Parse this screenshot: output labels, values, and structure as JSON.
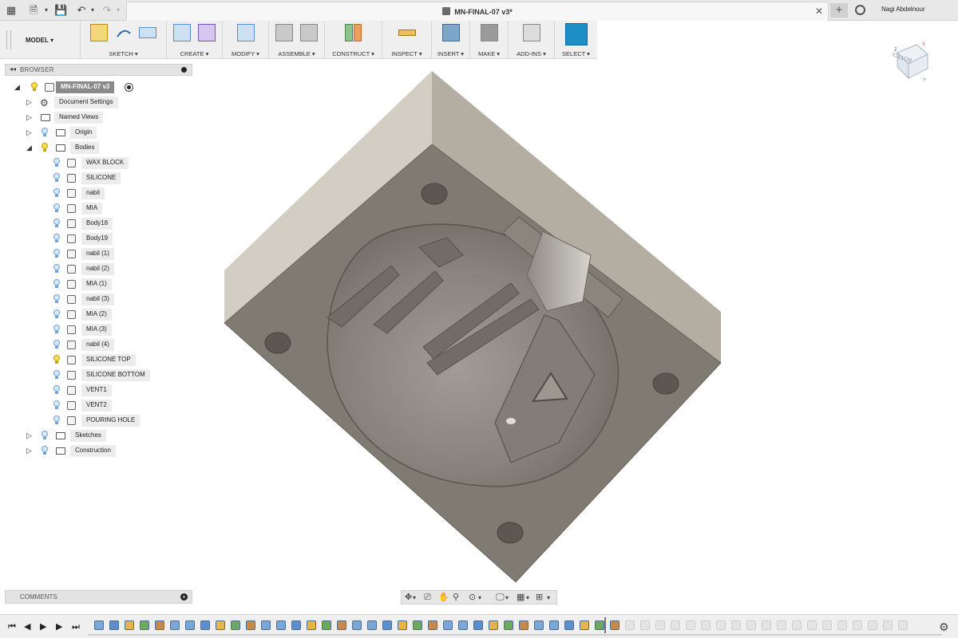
{
  "app": {
    "document_title": "MN-FINAL-07 v3*",
    "user_name": "Nagi Abdelnour"
  },
  "toolbar": {
    "workspace": "MODEL",
    "groups": [
      {
        "label": "SKETCH"
      },
      {
        "label": "CREATE"
      },
      {
        "label": "MODIFY"
      },
      {
        "label": "ASSEMBLE"
      },
      {
        "label": "CONSTRUCT"
      },
      {
        "label": "INSPECT"
      },
      {
        "label": "INSERT"
      },
      {
        "label": "MAKE"
      },
      {
        "label": "ADD-INS"
      },
      {
        "label": "SELECT"
      }
    ]
  },
  "browser": {
    "title": "BROWSER",
    "root": "MN-FINAL-07 v3",
    "top_items": [
      "Document Settings",
      "Named Views",
      "Origin",
      "Bodies"
    ],
    "bodies": [
      "WAX BLOCK",
      "SILICONE",
      "nabil",
      "MIA",
      "Body18",
      "Body19",
      "nabil (1)",
      "nabil (2)",
      "MIA (1)",
      "nabil (3)",
      "MIA (2)",
      "MIA (3)",
      "nabil (4)",
      "SILICONE TOP",
      "SILICONE BOTTOM",
      "VENT1",
      "VENT2",
      "POURING HOLE"
    ],
    "bottom_items": [
      "Sketches",
      "Construction"
    ]
  },
  "comments": {
    "title": "COMMENTS"
  },
  "viewcube": {
    "face": "BOTTOM",
    "axes": [
      "X",
      "Y",
      "Z"
    ]
  },
  "colors": {
    "accent_select": "#1e8fc6",
    "visible_bulb": "#6fa3d9",
    "active_bulb": "#f7dc5a",
    "model_gray": "#7f7a72"
  }
}
